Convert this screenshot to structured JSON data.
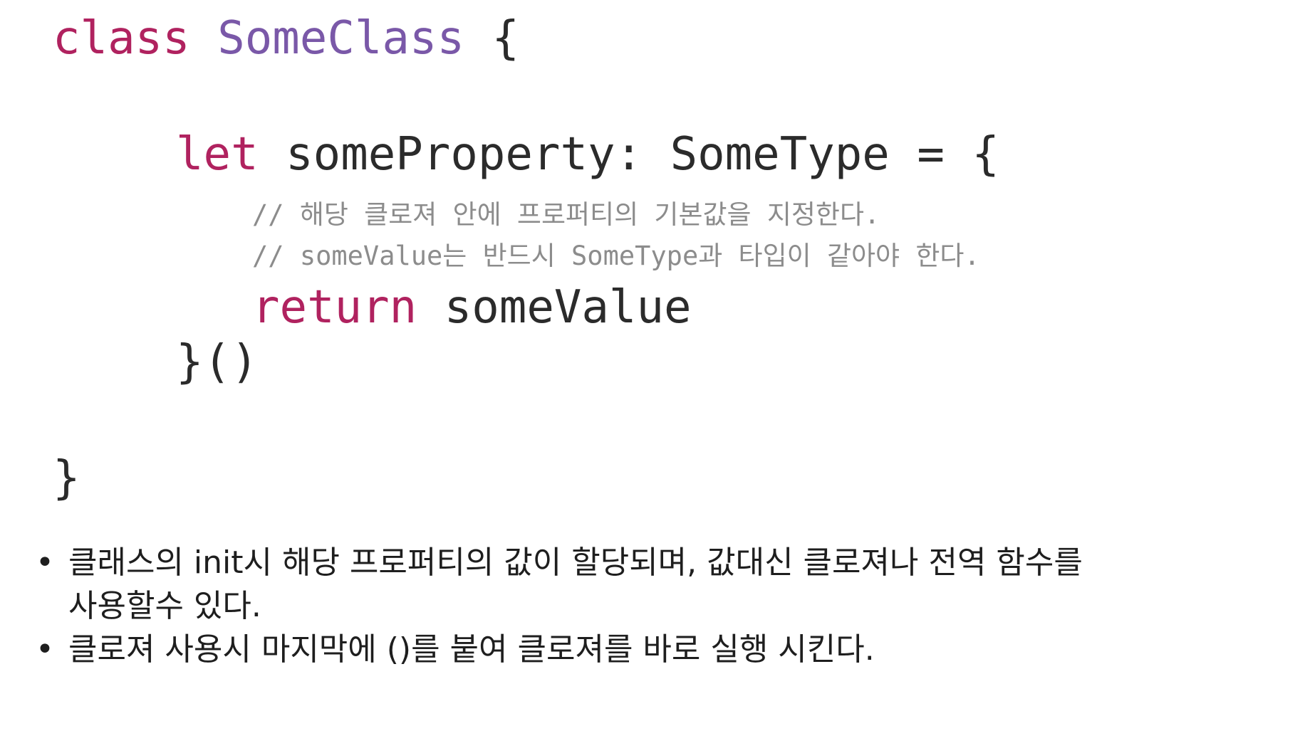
{
  "code": {
    "line1": {
      "kw": "class",
      "type": "SomeClass",
      "brace": "{"
    },
    "line2": {
      "kw": "let",
      "rest": "someProperty: SomeType = {"
    },
    "comment1": "// 해당 클로져 안에 프로퍼티의 기본값을 지정한다.",
    "comment2": "// someValue는 반드시 SomeType과 타입이 같아야 한다.",
    "line5": {
      "kw": "return",
      "rest": "someValue"
    },
    "line6": "}()",
    "line7": "}"
  },
  "notes": {
    "bullet_glyph": "•",
    "items": [
      {
        "line1": "클래스의 init시 해당 프로퍼티의 값이 할당되며, 값대신 클로져나 전역 함수를",
        "line2": "사용할수 있다."
      },
      {
        "line1": "클로져 사용시 마지막에  ()를 붙여 클로져를 바로 실행 시킨다."
      }
    ]
  }
}
